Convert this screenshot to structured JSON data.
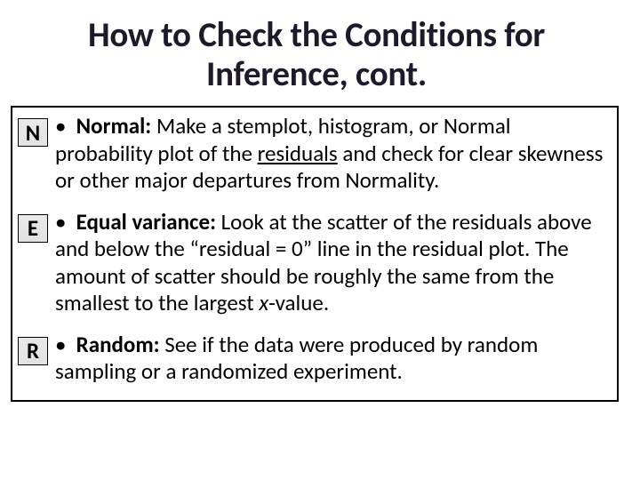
{
  "title": "How to Check the Conditions for Inference, cont.",
  "items": [
    {
      "letter": "N",
      "term": "Normal:",
      "text_before": " Make a stemplot, histogram, or Normal probability plot of the ",
      "underlined": "residuals",
      "text_after": " and check for clear skewness or other major departures from Normality."
    },
    {
      "letter": "E",
      "term": "Equal variance:",
      "text_before": " Look at the scatter of the residuals above and below the “residual = 0” line in the residual plot. The amount of scatter should be roughly the same from the smallest to the largest ",
      "ital": "x",
      "text_after": "-value."
    },
    {
      "letter": "R",
      "term": "Random:",
      "text_before": " See if the data were produced by random sampling or a randomized experiment.",
      "text_after": ""
    }
  ]
}
